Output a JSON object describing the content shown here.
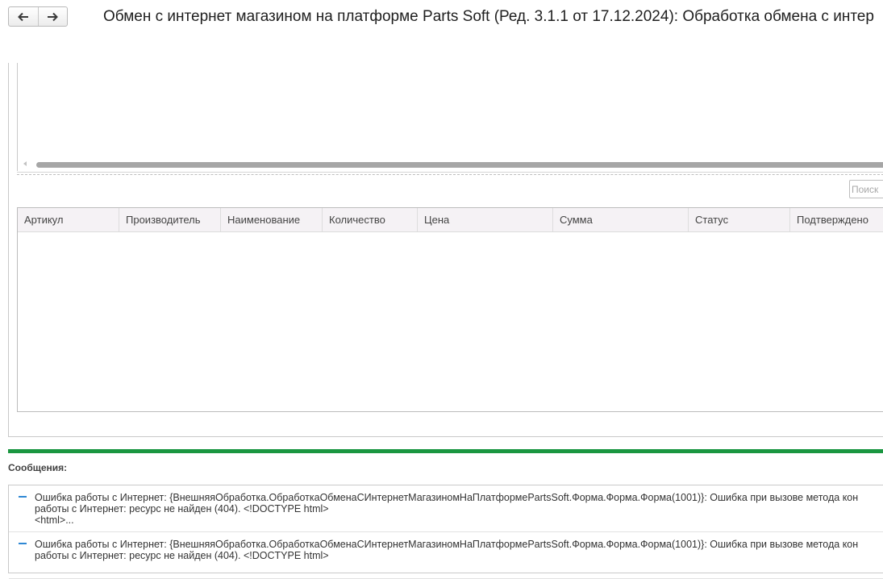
{
  "header": {
    "title": "Обмен с интернет магазином на платформе Parts Soft (Ред. 3.1.1 от 17.12.2024): Обработка обмена с интер",
    "back_icon": "arrow-left-icon",
    "forward_icon": "arrow-right-icon"
  },
  "search": {
    "placeholder": "Поиск"
  },
  "table": {
    "columns": [
      "Артикул",
      "Производитель",
      "Наименование",
      "Количество",
      "Цена",
      "Сумма",
      "Статус",
      "Подтверждено"
    ],
    "rows": []
  },
  "messages": {
    "title": "Сообщения:",
    "items": [
      {
        "line1": "Ошибка работы с Интернет: {ВнешняяОбработка.ОбработкаОбменаСИнтернетМагазиномНаПлатформеPartsSoft.Форма.Форма.Форма(1001)}: Ошибка при вызове метода кон",
        "line2": "работы с Интернет:  ресурс не найден (404). <!DOCTYPE html>",
        "line3": "<html>..."
      },
      {
        "line1": "Ошибка работы с Интернет: {ВнешняяОбработка.ОбработкаОбменаСИнтернетМагазиномНаПлатформеPartsSoft.Форма.Форма.Форма(1001)}: Ошибка при вызове метода кон",
        "line2": "работы с Интернет:  ресурс не найден (404). <!DOCTYPE html>"
      }
    ]
  },
  "colors": {
    "accent_green": "#1a9640",
    "message_marker": "#2f88d4"
  }
}
